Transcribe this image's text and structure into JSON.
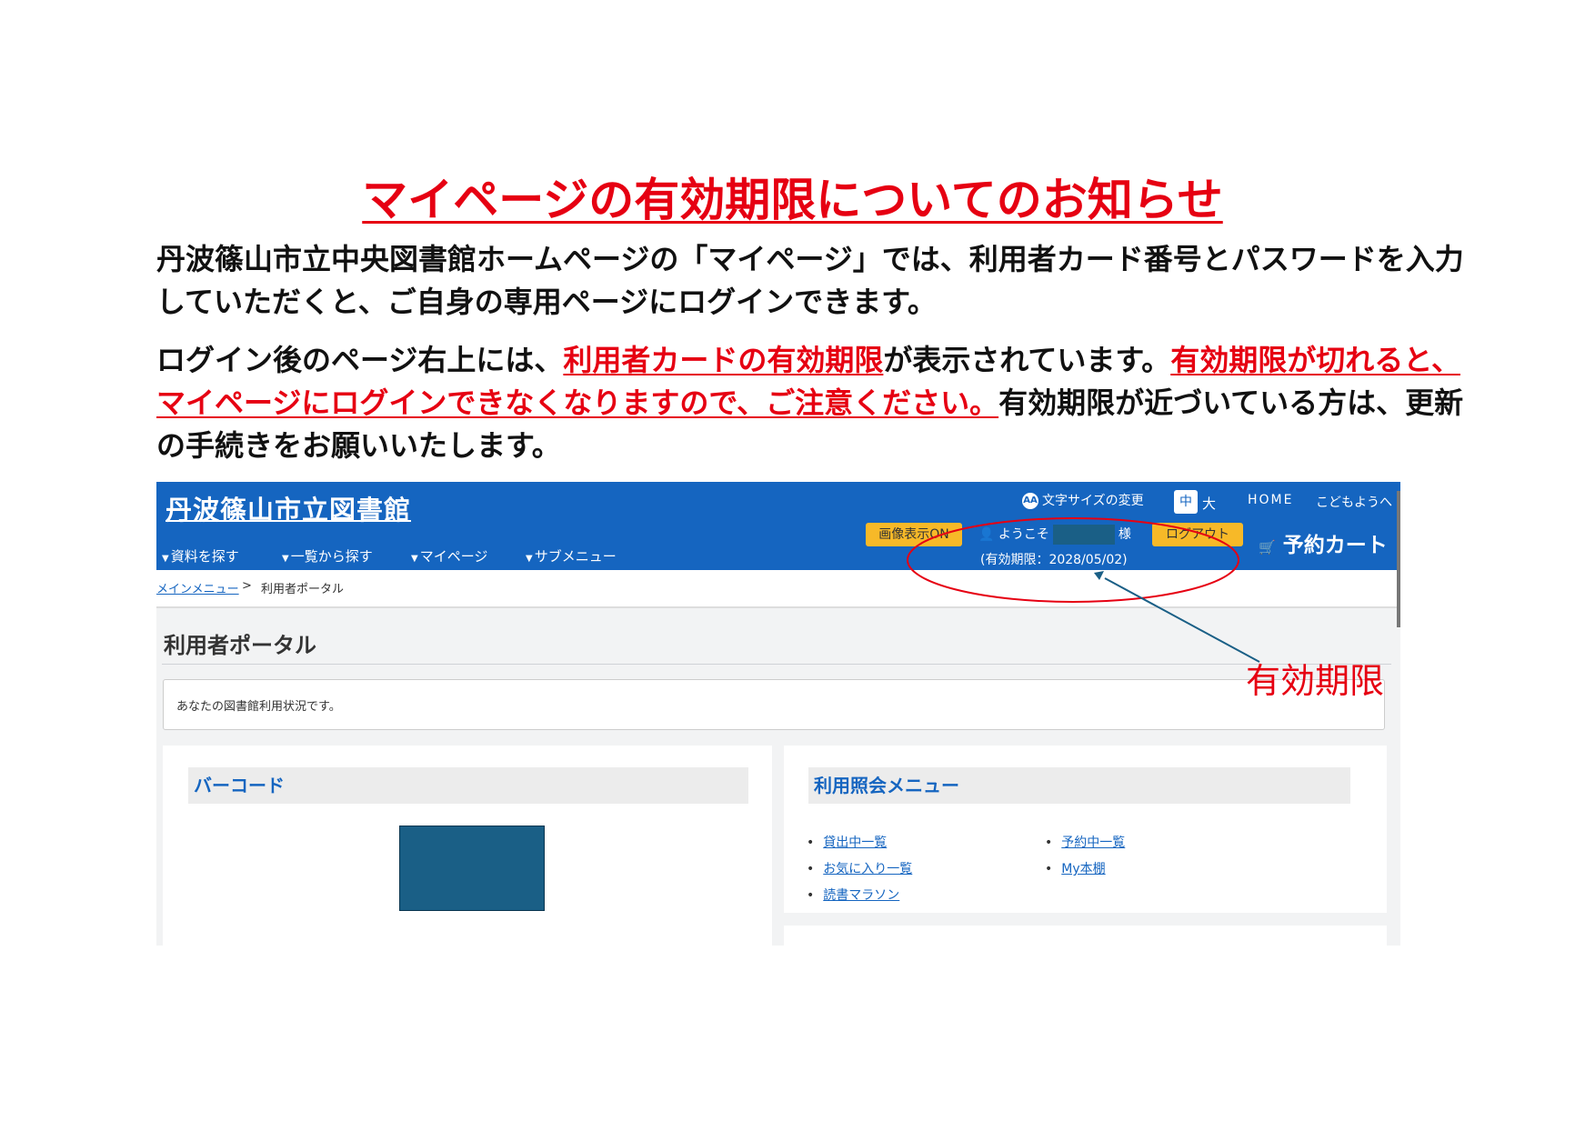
{
  "document": {
    "title": "マイページの有効期限についてのお知らせ",
    "para1": "丹波篠山市立中央図書館ホームページの「マイページ」では、利用者カード番号とパスワードを入力していただくと、ご自身の専用ページにログインできます。",
    "para2_a": "ログイン後のページ右上には、",
    "para2_b": "利用者カードの有効期限",
    "para2_c": "が表示されています。",
    "para2_d": "有効期限が切れると、マイページにログインできなくなりますので、ご注意ください。",
    "para2_e": "有効期限が近づいている方は、更新の手続きをお願いいたします。",
    "annotation_label": "有効期限"
  },
  "screenshot": {
    "site_name": "丹波篠山市立図書館",
    "nav": [
      "資料を探す",
      "一覧から探す",
      "マイページ",
      "サブメニュー"
    ],
    "font_size_label": "文字サイズの変更",
    "font_size_icon": "AA",
    "font_mid": "中",
    "font_big": "大",
    "home": "HOME",
    "kids": "こどもようへ",
    "image_toggle": "画像表示ON",
    "welcome_prefix": "ようこそ",
    "welcome_suffix": "様",
    "expiry": "(有効期限：2028/05/02)",
    "logout": "ログアウト",
    "cart": "予約カート",
    "breadcrumb_link": "メインメニュー",
    "breadcrumb_sep": ">",
    "breadcrumb_current": "利用者ポータル",
    "page_title": "利用者ポータル",
    "info_text": "あなたの図書館利用状況です。",
    "barcode_title": "バーコード",
    "menu_title": "利用照会メニュー",
    "menu_left": [
      "貸出中一覧",
      "お気に入り一覧",
      "読書マラソン"
    ],
    "menu_right": [
      "予約中一覧",
      "My本棚"
    ]
  },
  "colors": {
    "accent_red": "#e60012",
    "header_blue": "#1565c0",
    "button_yellow": "#f7b928"
  }
}
